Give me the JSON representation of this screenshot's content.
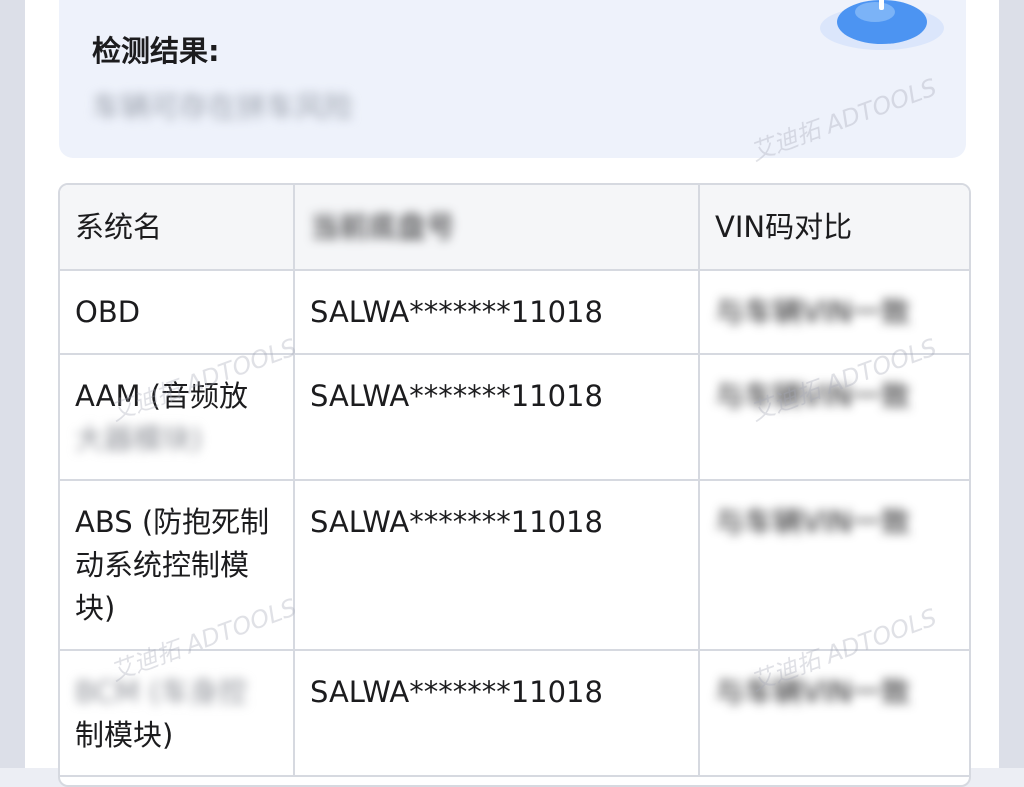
{
  "result": {
    "title": "检测结果:",
    "value": "车辆可存在拼车风险"
  },
  "table": {
    "headers": [
      "系统名",
      "当前底盘号",
      "VIN码对比"
    ],
    "rows": [
      {
        "system": "OBD",
        "vin": "SALWA*******11018",
        "compare": "与车辆VIN一致"
      },
      {
        "system": "AAM (音频放",
        "system_hidden": "大器模块)",
        "vin": "SALWA*******11018",
        "compare": "与车辆VIN一致"
      },
      {
        "system": "ABS (防抱死制动系统控制模块)",
        "vin": "SALWA*******11018",
        "compare": "与车辆VIN一致"
      },
      {
        "system_hidden": "BCM (车身控",
        "system": "制模块)",
        "vin": "SALWA*******11018",
        "compare": "与车辆VIN一致"
      }
    ]
  },
  "watermark": "艾迪拓 ADTOOLS",
  "colors": {
    "panel_bg": "#eef2fb",
    "border": "#d6d9e0",
    "header_bg": "#f5f6f8",
    "accent_blue": "#3d8ef0"
  }
}
